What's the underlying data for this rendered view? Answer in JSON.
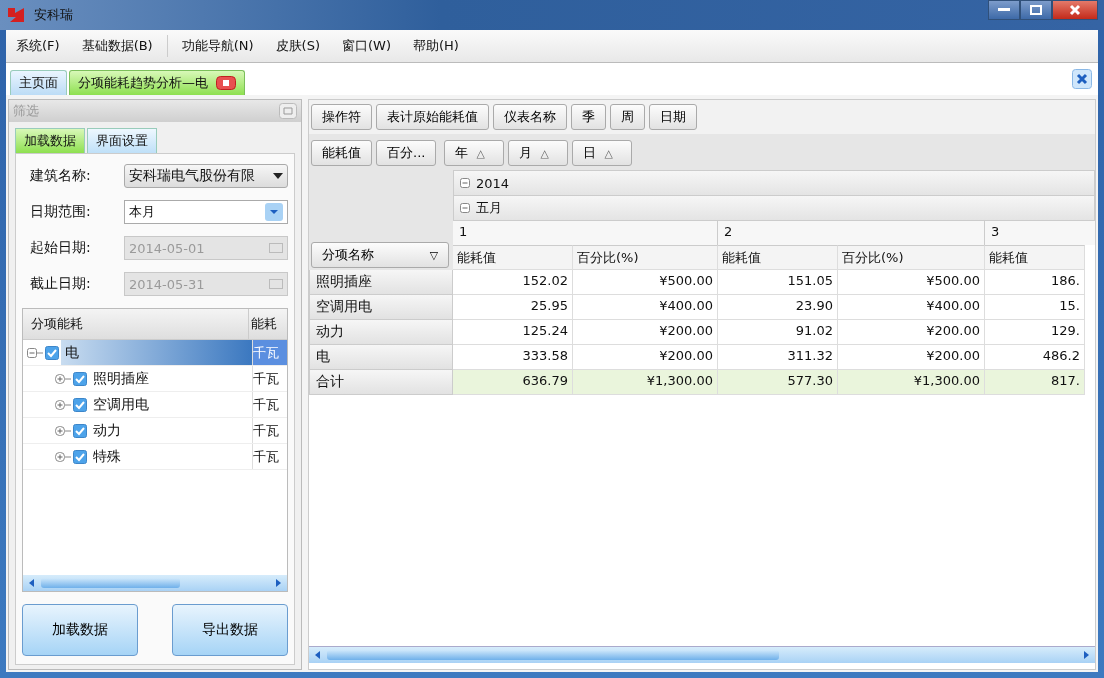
{
  "window": {
    "title": "安科瑞"
  },
  "menu": [
    "系统(F)",
    "基础数据(B)",
    "功能导航(N)",
    "皮肤(S)",
    "窗口(W)",
    "帮助(H)"
  ],
  "tabs": [
    {
      "label": "主页面",
      "selected": false,
      "closable": false
    },
    {
      "label": "分项能耗趋势分析—电",
      "selected": true,
      "closable": true
    }
  ],
  "filter_panel": {
    "title": "筛选",
    "tabs": [
      {
        "label": "加载数据",
        "selected": true
      },
      {
        "label": "界面设置",
        "selected": false
      }
    ],
    "fields": [
      {
        "label": "建筑名称:",
        "kind": "dropdown",
        "value": "安科瑞电气股份有限"
      },
      {
        "label": "日期范围:",
        "kind": "combo",
        "value": "本月"
      },
      {
        "label": "起始日期:",
        "kind": "date",
        "value": "2014-05-01",
        "disabled": true
      },
      {
        "label": "截止日期:",
        "kind": "date",
        "value": "2014-05-31",
        "disabled": true
      }
    ],
    "tree": {
      "columns": [
        "分项能耗",
        "能耗"
      ],
      "items": [
        {
          "name": "电",
          "unit": "千瓦",
          "checked": true,
          "selected": true,
          "expanded": true,
          "children": [
            {
              "name": "照明插座",
              "unit": "千瓦",
              "checked": true,
              "selected": false,
              "expanded": false
            },
            {
              "name": "空调用电",
              "unit": "千瓦",
              "checked": true,
              "selected": false,
              "expanded": false
            },
            {
              "name": "动力",
              "unit": "千瓦",
              "checked": true,
              "selected": false,
              "expanded": false
            },
            {
              "name": "特殊",
              "unit": "千瓦",
              "checked": true,
              "selected": false,
              "expanded": false
            }
          ]
        }
      ]
    },
    "buttons": [
      "加载数据",
      "导出数据"
    ]
  },
  "pivot": {
    "filter_fields": [
      "操作符",
      "表计原始能耗值",
      "仪表名称",
      "季",
      "周",
      "日期"
    ],
    "data_fields": [
      "能耗值",
      "百分..."
    ],
    "column_fields": [
      {
        "label": "年",
        "sort": "△"
      },
      {
        "label": "月",
        "sort": "△"
      },
      {
        "label": "日",
        "sort": "△"
      }
    ],
    "year": "2014",
    "month": "五月",
    "days": [
      "1",
      "2",
      "3"
    ],
    "value_headers": [
      "能耗值",
      "百分比(%)",
      "能耗值",
      "百分比(%)",
      "能耗值"
    ],
    "row_field": {
      "label": "分项名称",
      "filter": "▽"
    },
    "rows": [
      {
        "label": "照明插座",
        "kind": "data",
        "cells": [
          "152.02",
          "¥500.00",
          "151.05",
          "¥500.00",
          "186."
        ]
      },
      {
        "label": "空调用电",
        "kind": "data",
        "cells": [
          "25.95",
          "¥400.00",
          "23.90",
          "¥400.00",
          "15."
        ]
      },
      {
        "label": "动力",
        "kind": "data",
        "cells": [
          "125.24",
          "¥200.00",
          "91.02",
          "¥200.00",
          "129."
        ]
      },
      {
        "label": "电",
        "kind": "data",
        "cells": [
          "333.58",
          "¥200.00",
          "311.32",
          "¥200.00",
          "486.2"
        ]
      },
      {
        "label": "合计",
        "kind": "total",
        "cells": [
          "636.79",
          "¥1,300.00",
          "577.30",
          "¥1,300.00",
          "817."
        ]
      }
    ]
  }
}
